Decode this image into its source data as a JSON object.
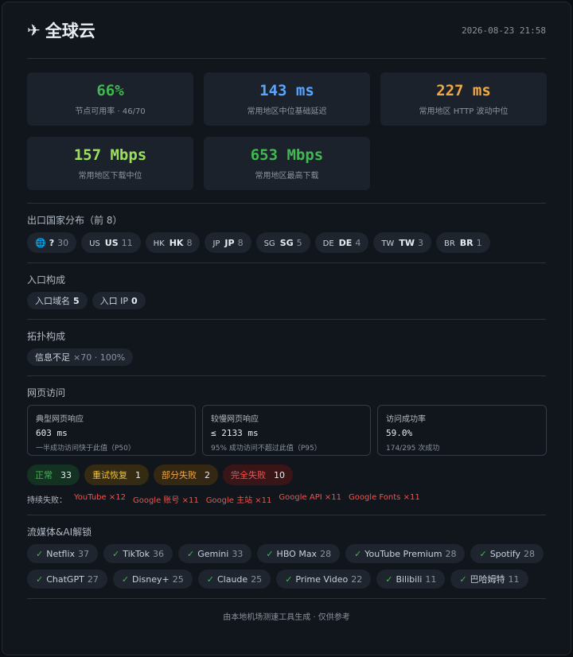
{
  "header": {
    "icon": "airplane-icon",
    "title": "全球云",
    "timestamp": "2026-08-23 21:58"
  },
  "stats": [
    {
      "value": "66%",
      "label": "节点可用率 · 46/70",
      "color": "#3fb950"
    },
    {
      "value": "143 ms",
      "label": "常用地区中位基础延迟",
      "color": "#58a6ff"
    },
    {
      "value": "227 ms",
      "label": "常用地区 HTTP 波动中位",
      "color": "#f0a848"
    },
    {
      "value": "157 Mbps",
      "label": "常用地区下载中位",
      "color": "#9be05a"
    },
    {
      "value": "653 Mbps",
      "label": "常用地区最高下载",
      "color": "#3fb950"
    }
  ],
  "countries": {
    "title": "出口国家分布（前 8）",
    "items": [
      {
        "flag": "🌐",
        "code": "?",
        "count": "30"
      },
      {
        "flag": "US",
        "code": "US",
        "count": "11"
      },
      {
        "flag": "HK",
        "code": "HK",
        "count": "8"
      },
      {
        "flag": "JP",
        "code": "JP",
        "count": "8"
      },
      {
        "flag": "SG",
        "code": "SG",
        "count": "5"
      },
      {
        "flag": "DE",
        "code": "DE",
        "count": "4"
      },
      {
        "flag": "TW",
        "code": "TW",
        "count": "3"
      },
      {
        "flag": "BR",
        "code": "BR",
        "count": "1"
      }
    ]
  },
  "entry": {
    "title": "入口构成",
    "items": [
      {
        "label": "入口域名",
        "value": "5"
      },
      {
        "label": "入口 IP",
        "value": "0"
      }
    ]
  },
  "topology": {
    "title": "拓扑构成",
    "label": "信息不足",
    "detail": "×70 · 100%"
  },
  "web": {
    "title": "网页访问",
    "boxes": [
      {
        "title": "典型网页响应",
        "value": "603 ms",
        "sub": "一半成功访问快于此值（P50）"
      },
      {
        "title": "较慢网页响应",
        "value": "≤ 2133 ms",
        "sub": "95% 成功访问不超过此值（P95）"
      },
      {
        "title": "访问成功率",
        "value": "59.0%",
        "sub": "174/295 次成功"
      }
    ],
    "statuses": [
      {
        "label": "正常",
        "count": "33",
        "kind": "ok"
      },
      {
        "label": "重试恢复",
        "count": "1",
        "kind": "retry"
      },
      {
        "label": "部分失败",
        "count": "2",
        "kind": "partial"
      },
      {
        "label": "完全失败",
        "count": "10",
        "kind": "fail"
      }
    ],
    "fail_label": "持续失败：",
    "fails": [
      "YouTube ×12",
      "Google 账号 ×11",
      "Google 主站 ×11",
      "Google API ×11",
      "Google Fonts ×11"
    ]
  },
  "streaming": {
    "title": "流媒体&AI解锁",
    "items": [
      {
        "name": "Netflix",
        "count": "37"
      },
      {
        "name": "TikTok",
        "count": "36"
      },
      {
        "name": "Gemini",
        "count": "33"
      },
      {
        "name": "HBO Max",
        "count": "28"
      },
      {
        "name": "YouTube Premium",
        "count": "28"
      },
      {
        "name": "Spotify",
        "count": "28"
      },
      {
        "name": "ChatGPT",
        "count": "27"
      },
      {
        "name": "Disney+",
        "count": "25"
      },
      {
        "name": "Claude",
        "count": "25"
      },
      {
        "name": "Prime Video",
        "count": "22"
      },
      {
        "name": "Bilibili",
        "count": "11"
      },
      {
        "name": "巴哈姆特",
        "count": "11"
      }
    ]
  },
  "footer": {
    "text": "由本地机场测速工具生成 · 仅供参考"
  }
}
